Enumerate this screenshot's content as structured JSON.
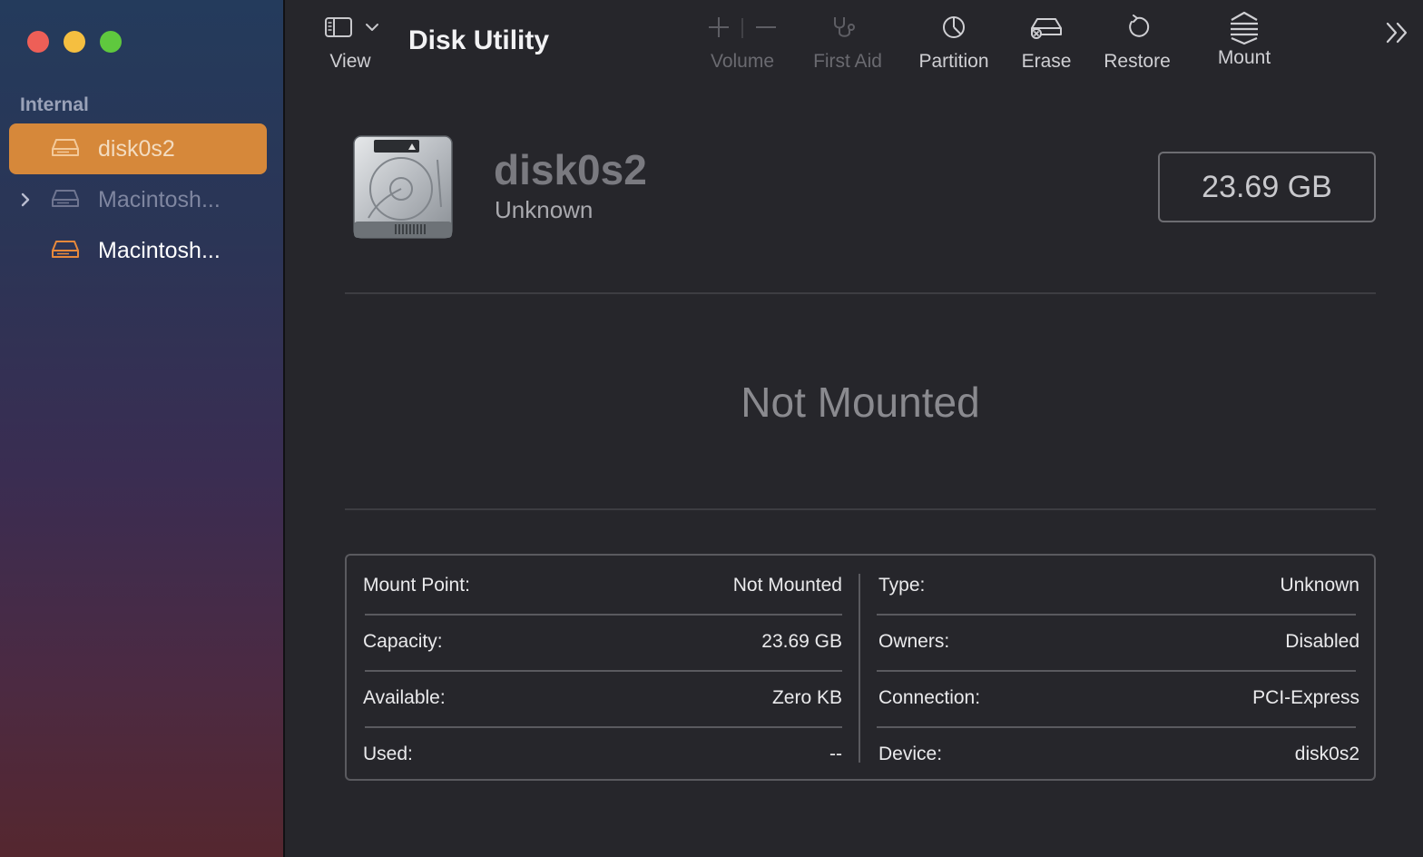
{
  "window": {
    "title": "Disk Utility"
  },
  "sidebar": {
    "section": "Internal",
    "items": [
      {
        "label": "disk0s2",
        "selected": true
      },
      {
        "label": "Macintosh...",
        "expandable": true
      },
      {
        "label": "Macintosh..."
      }
    ]
  },
  "toolbar": {
    "view_label": "View",
    "volume_label": "Volume",
    "first_aid_label": "First Aid",
    "partition_label": "Partition",
    "erase_label": "Erase",
    "restore_label": "Restore",
    "mount_label": "Mount"
  },
  "disk": {
    "name": "disk0s2",
    "subtitle": "Unknown",
    "size": "23.69 GB",
    "status": "Not Mounted"
  },
  "info": {
    "left": [
      {
        "key": "Mount Point:",
        "value": "Not Mounted"
      },
      {
        "key": "Capacity:",
        "value": "23.69 GB"
      },
      {
        "key": "Available:",
        "value": "Zero KB"
      },
      {
        "key": "Used:",
        "value": "--"
      }
    ],
    "right": [
      {
        "key": "Type:",
        "value": "Unknown"
      },
      {
        "key": "Owners:",
        "value": "Disabled"
      },
      {
        "key": "Connection:",
        "value": "PCI-Express"
      },
      {
        "key": "Device:",
        "value": "disk0s2"
      }
    ]
  },
  "colors": {
    "accent": "#d6883a",
    "background": "#26262b",
    "disabled_text": "#6a6a70"
  },
  "icons": [
    "sidebar-toggle-icon",
    "chevron-down-icon",
    "plus-icon",
    "minus-icon",
    "stethoscope-icon",
    "pie-chart-icon",
    "erase-icon",
    "restore-icon",
    "mount-icon",
    "more-chevrons-icon",
    "hard-disk-icon",
    "disclosure-chevron-icon"
  ]
}
